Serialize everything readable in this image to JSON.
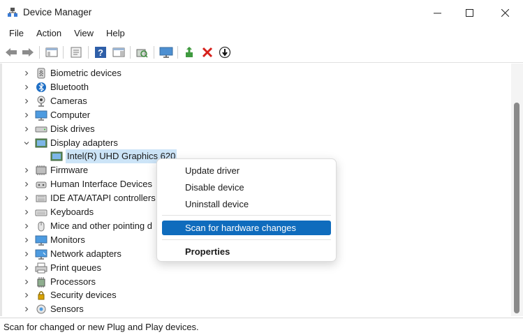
{
  "window": {
    "title": "Device Manager",
    "controls": {
      "minimize": "—",
      "maximize": "☐",
      "close": "✕"
    }
  },
  "menubar": [
    "File",
    "Action",
    "View",
    "Help"
  ],
  "toolbar": {
    "buttons": [
      "back-arrow-icon",
      "forward-arrow-icon",
      "show-hide-tree-icon",
      "properties-icon",
      "help-icon",
      "action-pane-icon",
      "scan-hardware-icon",
      "monitor-icon",
      "update-driver-icon",
      "uninstall-icon",
      "disable-icon"
    ]
  },
  "tree": {
    "items": [
      {
        "label": "Biometric devices",
        "icon": "biometric-icon",
        "expanded": false
      },
      {
        "label": "Bluetooth",
        "icon": "bluetooth-icon",
        "expanded": false
      },
      {
        "label": "Cameras",
        "icon": "camera-icon",
        "expanded": false
      },
      {
        "label": "Computer",
        "icon": "computer-icon",
        "expanded": false
      },
      {
        "label": "Disk drives",
        "icon": "disk-drive-icon",
        "expanded": false
      },
      {
        "label": "Display adapters",
        "icon": "display-adapter-icon",
        "expanded": true
      },
      {
        "label": "Intel(R) UHD Graphics 620",
        "icon": "display-adapter-icon",
        "child": true,
        "selected": true
      },
      {
        "label": "Firmware",
        "icon": "firmware-icon",
        "expanded": false
      },
      {
        "label": "Human Interface Devices",
        "icon": "hid-icon",
        "expanded": false
      },
      {
        "label": "IDE ATA/ATAPI controllers",
        "icon": "ide-controller-icon",
        "expanded": false
      },
      {
        "label": "Keyboards",
        "icon": "keyboard-icon",
        "expanded": false
      },
      {
        "label": "Mice and other pointing d",
        "icon": "mouse-icon",
        "expanded": false
      },
      {
        "label": "Monitors",
        "icon": "monitor-icon",
        "expanded": false
      },
      {
        "label": "Network adapters",
        "icon": "network-adapter-icon",
        "expanded": false
      },
      {
        "label": "Print queues",
        "icon": "printer-icon",
        "expanded": false
      },
      {
        "label": "Processors",
        "icon": "processor-icon",
        "expanded": false
      },
      {
        "label": "Security devices",
        "icon": "security-device-icon",
        "expanded": false
      },
      {
        "label": "Sensors",
        "icon": "sensor-icon",
        "expanded": false
      }
    ]
  },
  "context_menu": {
    "items": [
      {
        "label": "Update driver"
      },
      {
        "label": "Disable device"
      },
      {
        "label": "Uninstall device"
      },
      {
        "label": "Scan for hardware changes",
        "highlighted": true
      },
      {
        "label": "Properties",
        "bold": true
      }
    ]
  },
  "status": {
    "text": "Scan for changed or new Plug and Play devices."
  },
  "colors": {
    "highlight": "#0f6cbd",
    "selection": "#cce4f7",
    "close_red": "#d6201b"
  }
}
